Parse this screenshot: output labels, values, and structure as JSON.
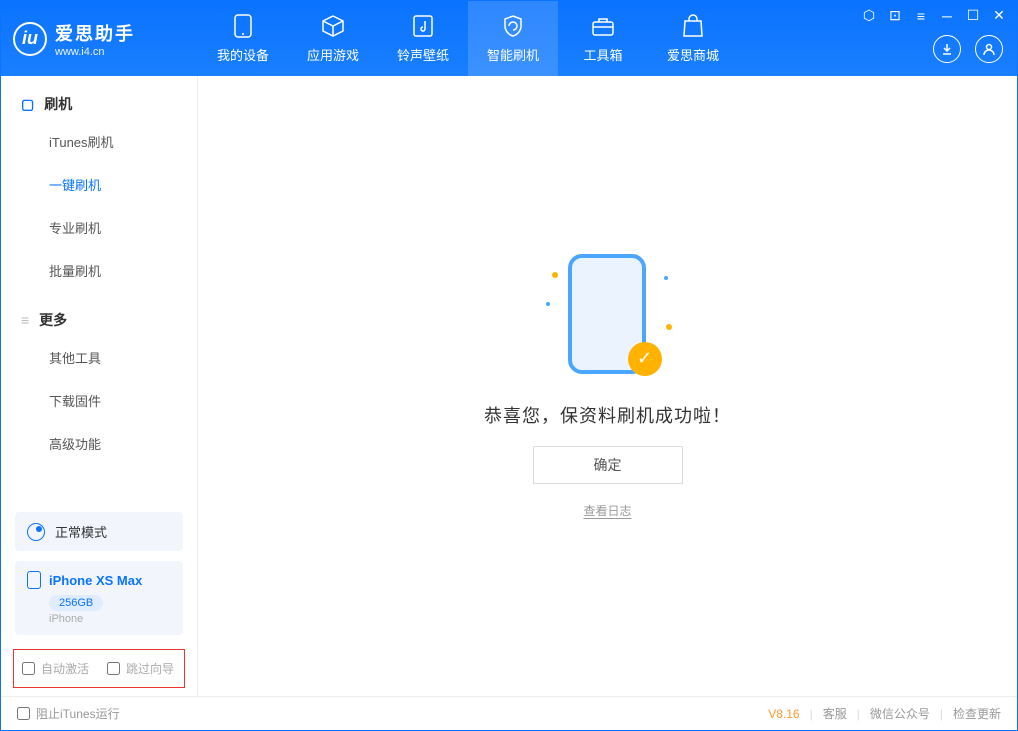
{
  "app": {
    "name": "爱思助手",
    "url": "www.i4.cn"
  },
  "tabs": [
    {
      "label": "我的设备"
    },
    {
      "label": "应用游戏"
    },
    {
      "label": "铃声壁纸"
    },
    {
      "label": "智能刷机"
    },
    {
      "label": "工具箱"
    },
    {
      "label": "爱思商城"
    }
  ],
  "sidebar": {
    "section1": "刷机",
    "items1": [
      "iTunes刷机",
      "一键刷机",
      "专业刷机",
      "批量刷机"
    ],
    "section2": "更多",
    "items2": [
      "其他工具",
      "下载固件",
      "高级功能"
    ]
  },
  "mode": {
    "label": "正常模式"
  },
  "device": {
    "name": "iPhone XS Max",
    "storage": "256GB",
    "type": "iPhone"
  },
  "options": {
    "auto_activate": "自动激活",
    "skip_guide": "跳过向导"
  },
  "main": {
    "success": "恭喜您，保资料刷机成功啦！",
    "ok": "确定",
    "view_log": "查看日志"
  },
  "statusbar": {
    "block_itunes": "阻止iTunes运行",
    "version": "V8.16",
    "service": "客服",
    "wechat": "微信公众号",
    "update": "检查更新"
  }
}
